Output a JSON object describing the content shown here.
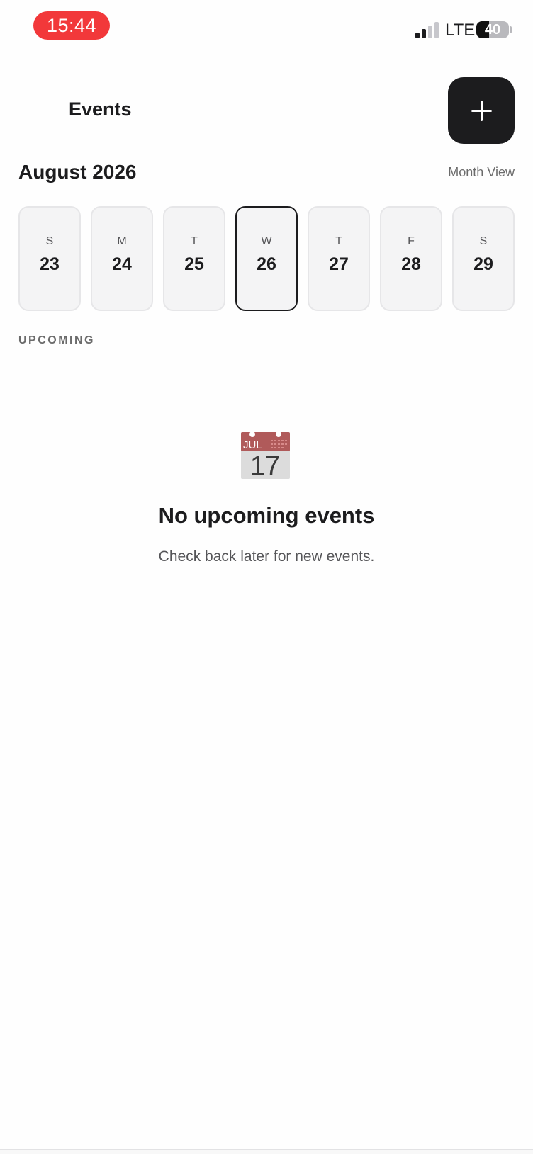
{
  "status_bar": {
    "time": "15:44",
    "network": "LTE",
    "battery": "40",
    "battery_level": 0.4,
    "signal_bars": 2,
    "time_pill_color": "#f2383a"
  },
  "header": {
    "title": "Events",
    "add_icon": "plus-icon"
  },
  "calendar": {
    "month": "August 2026",
    "view_toggle": "Month View",
    "selected_index": 3,
    "days": [
      {
        "dow": "S",
        "date": "23"
      },
      {
        "dow": "M",
        "date": "24"
      },
      {
        "dow": "T",
        "date": "25"
      },
      {
        "dow": "W",
        "date": "26"
      },
      {
        "dow": "T",
        "date": "27"
      },
      {
        "dow": "F",
        "date": "28"
      },
      {
        "dow": "S",
        "date": "29"
      }
    ]
  },
  "upcoming": {
    "section_label": "UPCOMING",
    "empty_icon": "calendar-icon",
    "empty_icon_month": "JUL",
    "empty_icon_day": "17",
    "empty_title": "No upcoming events",
    "empty_subtitle": "Check back later for new events."
  },
  "colors": {
    "accent": "#1c1c1e",
    "card_bg": "#f4f4f5",
    "muted_text": "#6b6b6b"
  }
}
